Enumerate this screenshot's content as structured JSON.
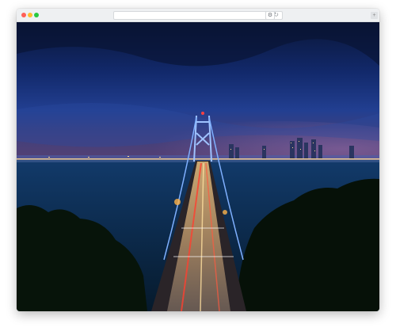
{
  "browser": {
    "url": "",
    "reload_icon": "↻",
    "extension_icon": "⚙",
    "corner_icon": "+"
  },
  "page": {
    "hero_image": "night-bridge-city-skyline-photo"
  },
  "colors": {
    "sky_top": "#0b1a4a",
    "sky_mid": "#1a3a8a",
    "water": "#0a2540",
    "bridge_lights": "#ffb347",
    "trees": "#071208"
  }
}
